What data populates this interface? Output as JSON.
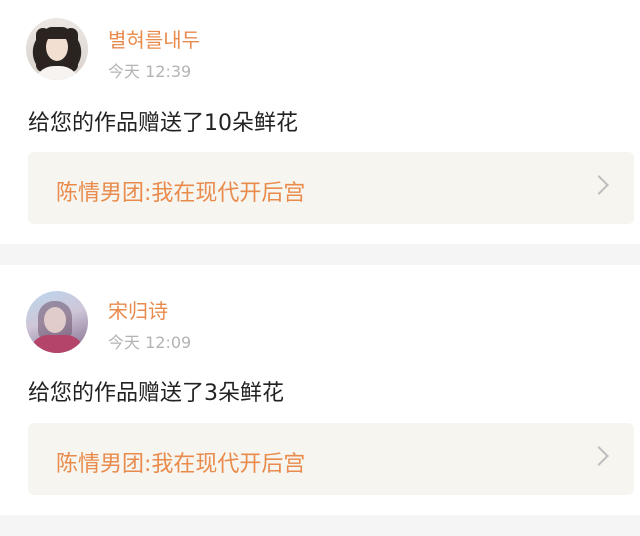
{
  "notifications": [
    {
      "username": "별혀를내두",
      "time": "今天 12:39",
      "message": "给您的作品赠送了10朵鲜花",
      "work_title": "陈情男团:我在现代开后宫",
      "avatar_icon": "user-avatar"
    },
    {
      "username": "宋归诗",
      "time": "今天 12:09",
      "message": "给您的作品赠送了3朵鲜花",
      "work_title": "陈情男团:我在现代开后宫",
      "avatar_icon": "user-avatar"
    }
  ],
  "colors": {
    "accent": "#e88b4c",
    "muted": "#b3b3b3",
    "text": "#222222",
    "link_bg": "#f7f5ef",
    "page_bg": "#f5f5f5"
  }
}
